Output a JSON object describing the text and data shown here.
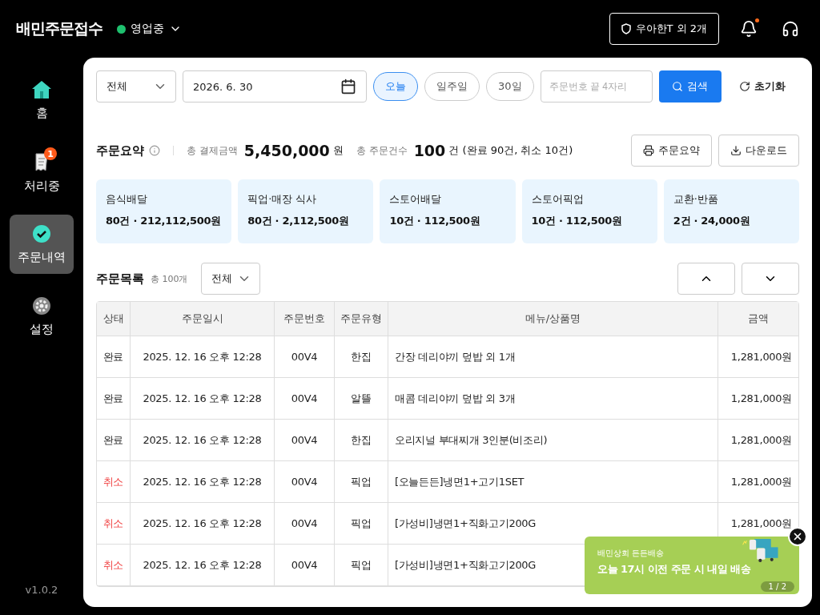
{
  "header": {
    "logo": "배민주문접수",
    "status": "영업중",
    "store_button": "우아한T 외 2개",
    "notification_dot": true
  },
  "sidebar": {
    "items": [
      {
        "label": "홈",
        "selected": false
      },
      {
        "label": "처리중",
        "selected": false,
        "badge": "1"
      },
      {
        "label": "주문내역",
        "selected": true
      },
      {
        "label": "설정",
        "selected": false
      }
    ],
    "version": "v1.0.2"
  },
  "filters": {
    "type_select": "전체",
    "date": "2026. 6. 30",
    "ranges": [
      {
        "label": "오늘",
        "selected": true
      },
      {
        "label": "일주일",
        "selected": false
      },
      {
        "label": "30일",
        "selected": false
      }
    ],
    "search_placeholder": "주문번호 끝 4자리",
    "search_button": "검색",
    "reset_button": "초기화"
  },
  "summary": {
    "title": "주문요약",
    "amount_label": "총 결제금액",
    "amount": "5,450,000",
    "amount_unit": "원",
    "count_label": "총 주문건수",
    "count": "100",
    "count_detail": "건 (완료 90건, 취소 10건)",
    "buttons": [
      {
        "label": "주문요약"
      },
      {
        "label": "다운로드"
      }
    ],
    "cards": [
      {
        "title": "음식배달",
        "value": "80건 · 212,112,500원"
      },
      {
        "title": "픽업·매장 식사",
        "value": "80건 · 2,112,500원"
      },
      {
        "title": "스토어배달",
        "value": "10건 · 112,500원"
      },
      {
        "title": "스토어픽업",
        "value": "10건 · 112,500원"
      },
      {
        "title": "교환·반품",
        "value": "2건 · 24,000원"
      }
    ]
  },
  "orders": {
    "title": "주문목록",
    "total": "총 100개",
    "filter": "전체",
    "table": {
      "columns": [
        "상태",
        "주문일시",
        "주문번호",
        "주문유형",
        "메뉴/상품명",
        "금액"
      ],
      "rows": [
        {
          "status": "완료",
          "cancelled": false,
          "date": "2025. 12. 16 오후 12:28",
          "number": "00V4",
          "type": "한집",
          "menu": "간장 데리야끼 덮밥 외 1개",
          "amount": "1,281,000원"
        },
        {
          "status": "완료",
          "cancelled": false,
          "date": "2025. 12. 16 오후 12:28",
          "number": "00V4",
          "type": "알뜰",
          "menu": "매콤 데리야끼 덮밥 외 3개",
          "amount": "1,281,000원"
        },
        {
          "status": "완료",
          "cancelled": false,
          "date": "2025. 12. 16 오후 12:28",
          "number": "00V4",
          "type": "한집",
          "menu": "오리지널 부대찌개 3인분(비조리)",
          "amount": "1,281,000원"
        },
        {
          "status": "취소",
          "cancelled": true,
          "date": "2025. 12. 16 오후 12:28",
          "number": "00V4",
          "type": "픽업",
          "menu": "[오늘든든]냉면1+고기1SET",
          "amount": "1,281,000원"
        },
        {
          "status": "취소",
          "cancelled": true,
          "date": "2025. 12. 16 오후 12:28",
          "number": "00V4",
          "type": "픽업",
          "menu": "[가성비]냉면1+직화고기200G",
          "amount": "1,281,000원"
        },
        {
          "status": "취소",
          "cancelled": true,
          "date": "2025. 12. 16 오후 12:28",
          "number": "00V4",
          "type": "픽업",
          "menu": "[가성비]냉면1+직화고기200G"
        }
      ]
    }
  },
  "banner": {
    "subtitle": "배민상회 든든배송",
    "title": "오늘 17시 이전 주문 시 내일 배송",
    "pager": "1 / 2"
  }
}
